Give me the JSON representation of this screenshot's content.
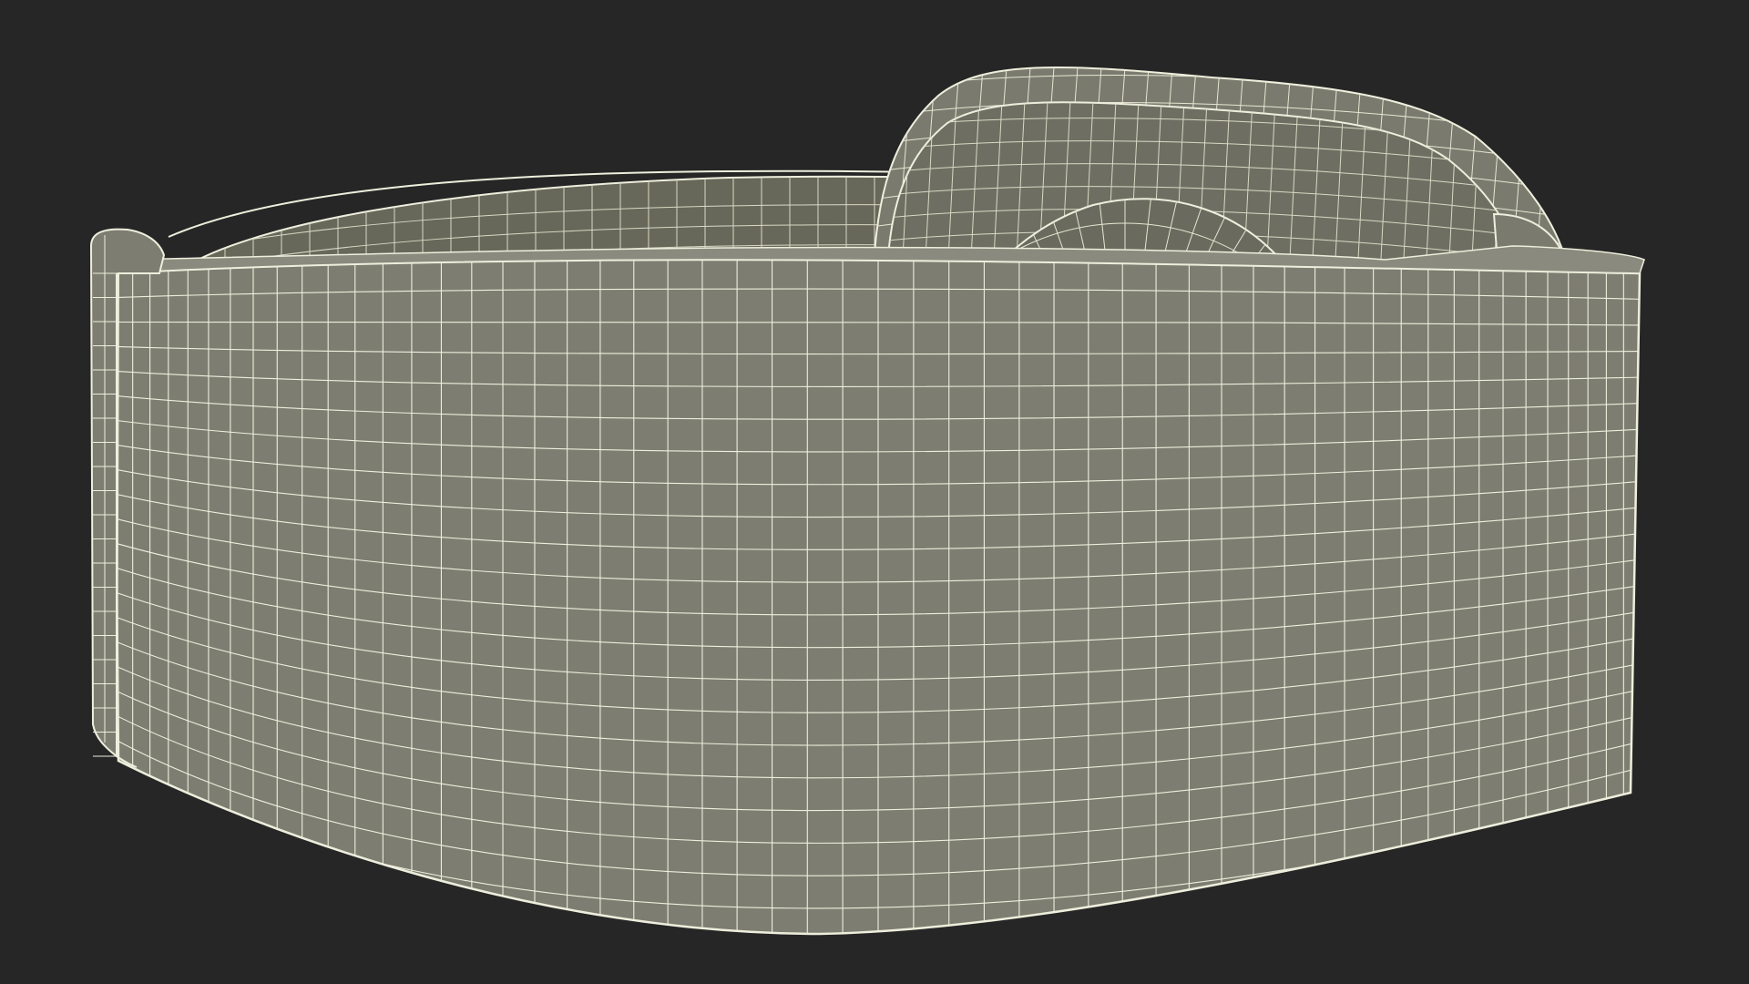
{
  "scene": {
    "subject": "wireframe-render",
    "colors": {
      "background": "#262626",
      "surface": "#7d7e71",
      "surface_dark": "#676859",
      "surface_shade": "#5f6053",
      "wire": "#eeeedd",
      "wire_soft": "#d8d8c4"
    },
    "objects": [
      "watch-band",
      "watch-case",
      "sensor-dome",
      "band-pin",
      "band-lug"
    ]
  }
}
